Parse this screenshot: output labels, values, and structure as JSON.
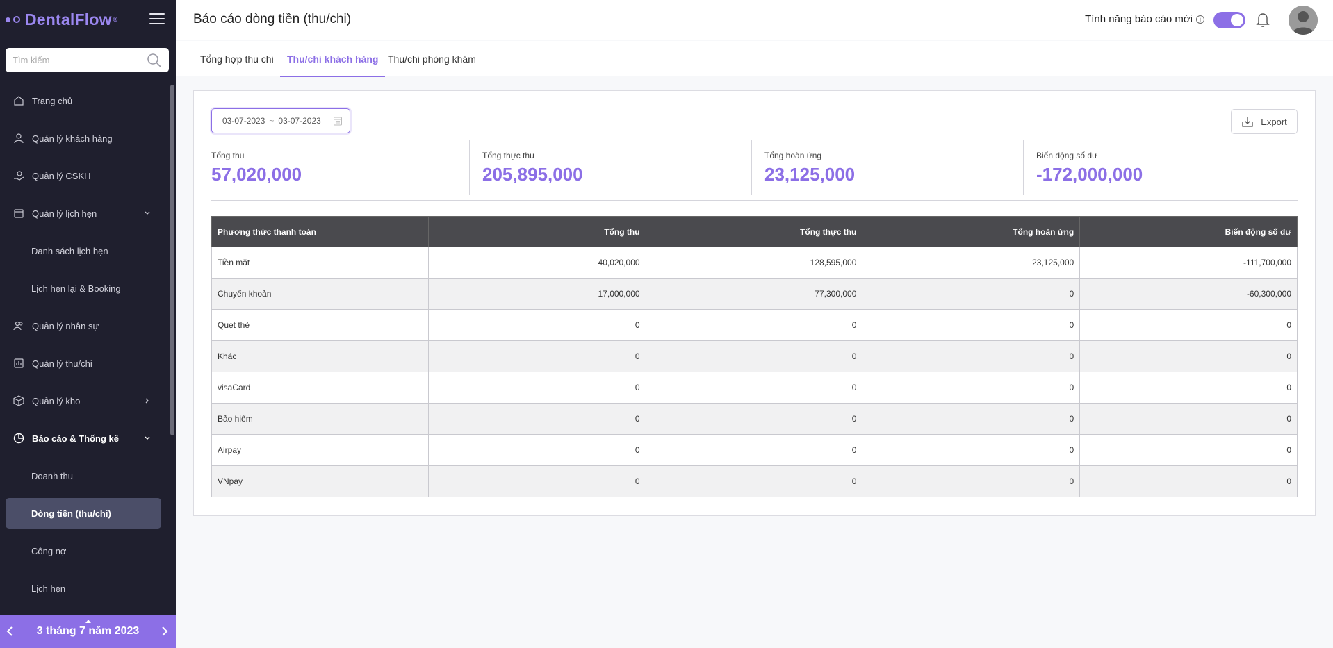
{
  "app": {
    "name": "DentalFlow",
    "trademark": "®"
  },
  "search": {
    "placeholder": "Tìm kiếm"
  },
  "sidebar": {
    "items": [
      {
        "label": "Trang chủ"
      },
      {
        "label": "Quản lý khách hàng"
      },
      {
        "label": "Quản lý CSKH"
      },
      {
        "label": "Quản lý lịch hẹn"
      },
      {
        "label": "Danh sách lịch hẹn"
      },
      {
        "label": "Lịch hẹn lại & Booking"
      },
      {
        "label": "Quản lý nhân sự"
      },
      {
        "label": "Quản lý thu/chi"
      },
      {
        "label": "Quản lý kho"
      },
      {
        "label": "Báo cáo & Thống kê"
      },
      {
        "label": "Doanh thu"
      },
      {
        "label": "Dòng tiền (thu/chi)"
      },
      {
        "label": "Công nợ"
      },
      {
        "label": "Lịch hẹn"
      }
    ]
  },
  "date_bar": {
    "label": "3 tháng 7 năm 2023"
  },
  "header": {
    "title": "Báo cáo dòng tiền (thu/chi)",
    "feature_label": "Tính năng báo cáo mới",
    "feature_info": "i",
    "toggle_on": true
  },
  "tabs": [
    {
      "label": "Tổng hợp thu chi"
    },
    {
      "label": "Thu/chi khách hàng"
    },
    {
      "label": "Thu/chi phòng khám"
    }
  ],
  "filter": {
    "date_from": "03-07-2023",
    "date_sep": "~",
    "date_to": "03-07-2023",
    "export_label": "Export"
  },
  "stats": [
    {
      "label": "Tổng thu",
      "value": "57,020,000"
    },
    {
      "label": "Tổng thực thu",
      "value": "205,895,000"
    },
    {
      "label": "Tổng hoàn ứng",
      "value": "23,125,000"
    },
    {
      "label": "Biến động số dư",
      "value": "-172,000,000"
    }
  ],
  "table": {
    "headers": [
      "Phương thức thanh toán",
      "Tổng thu",
      "Tổng thực thu",
      "Tổng hoàn ứng",
      "Biến động số dư"
    ],
    "rows": [
      [
        "Tiền mặt",
        "40,020,000",
        "128,595,000",
        "23,125,000",
        "-111,700,000"
      ],
      [
        "Chuyển khoản",
        "17,000,000",
        "77,300,000",
        "0",
        "-60,300,000"
      ],
      [
        "Quẹt thẻ",
        "0",
        "0",
        "0",
        "0"
      ],
      [
        "Khác",
        "0",
        "0",
        "0",
        "0"
      ],
      [
        "visaCard",
        "0",
        "0",
        "0",
        "0"
      ],
      [
        "Bảo hiểm",
        "0",
        "0",
        "0",
        "0"
      ],
      [
        "Airpay",
        "0",
        "0",
        "0",
        "0"
      ],
      [
        "VNpay",
        "0",
        "0",
        "0",
        "0"
      ]
    ]
  },
  "colors": {
    "accent": "#8c6fe6",
    "sidebar_bg": "#1f1f2e",
    "table_header": "#4a4a4e"
  }
}
